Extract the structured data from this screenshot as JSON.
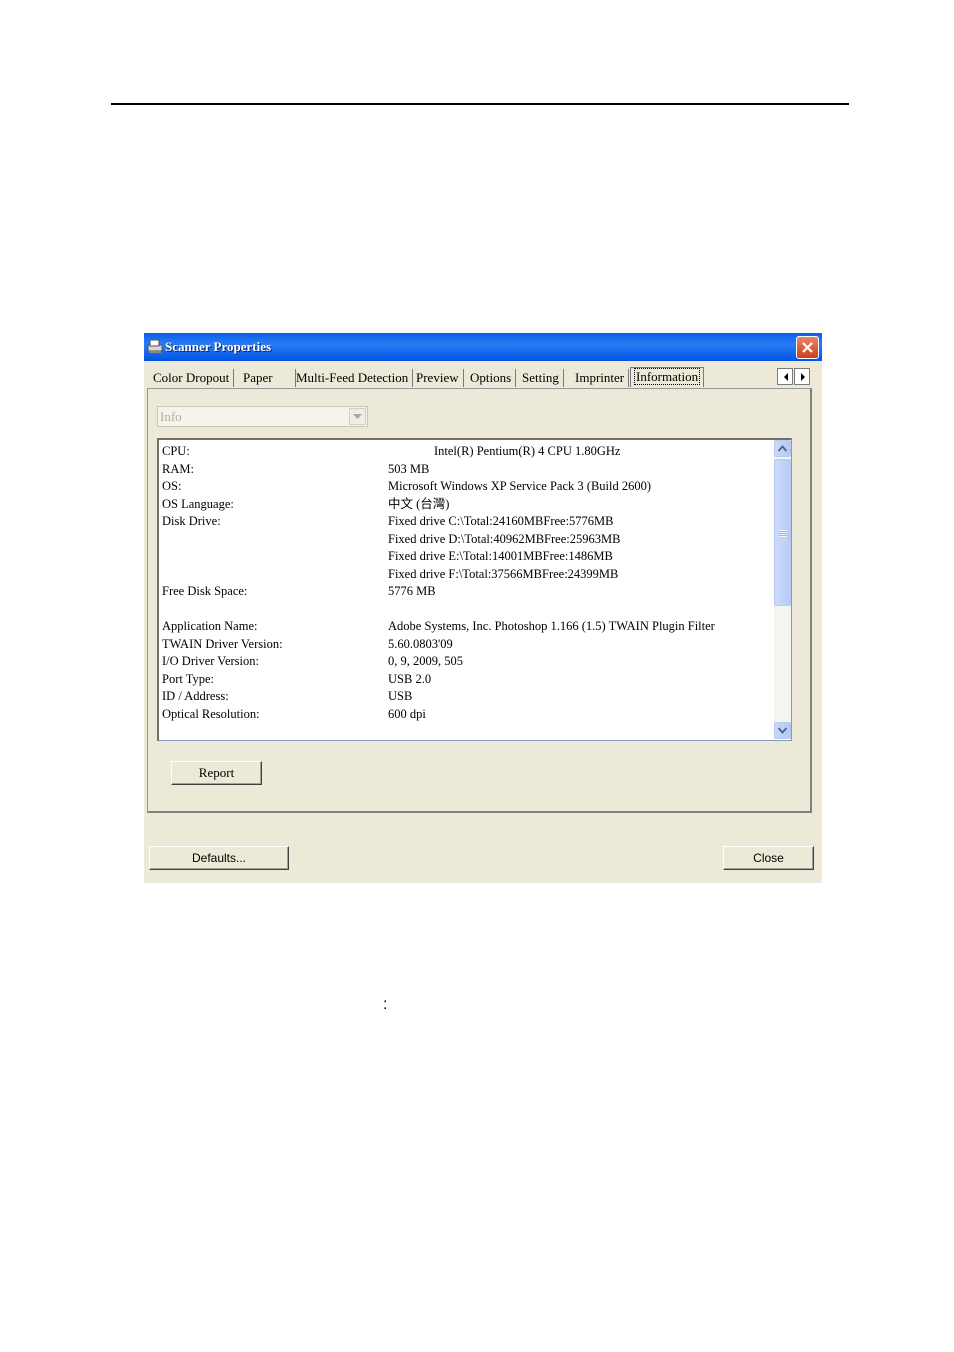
{
  "window": {
    "title": "Scanner Properties"
  },
  "tabs": [
    {
      "label": "Color Dropout"
    },
    {
      "label": "Paper"
    },
    {
      "label": "Multi-Feed Detection"
    },
    {
      "label": "Preview"
    },
    {
      "label": "Options"
    },
    {
      "label": "Setting"
    },
    {
      "label": "Imprinter"
    },
    {
      "label": "Information",
      "active": true
    }
  ],
  "combo": {
    "value": "Info"
  },
  "info": {
    "rows": [
      {
        "label": "CPU:",
        "value": "Intel(R) Pentium(R) 4 CPU 1.80GHz"
      },
      {
        "label": "RAM:",
        "value": "503 MB"
      },
      {
        "label": "OS:",
        "value": "Microsoft Windows XP Service Pack 3 (Build 2600)"
      },
      {
        "label": "OS Language:",
        "value": "中文 (台灣)"
      },
      {
        "label": "Disk Drive:",
        "value": "Fixed drive C:\\Total:24160MBFree:5776MB"
      },
      {
        "label": "",
        "value": "Fixed drive D:\\Total:40962MBFree:25963MB"
      },
      {
        "label": "",
        "value": "Fixed drive E:\\Total:14001MBFree:1486MB"
      },
      {
        "label": "",
        "value": "Fixed drive F:\\Total:37566MBFree:24399MB"
      },
      {
        "label": "Free Disk Space:",
        "value": "5776 MB"
      },
      {
        "label": "Application Name:",
        "value": "Adobe Systems, Inc. Photoshop 1.166 (1.5) TWAIN Plugin Filter"
      },
      {
        "label": "TWAIN Driver Version:",
        "value": "5.60.0803'09"
      },
      {
        "label": "I/O Driver Version:",
        "value": "0, 9, 2009, 505"
      },
      {
        "label": "Port Type:",
        "value": "USB 2.0"
      },
      {
        "label": "ID / Address:",
        "value": "USB"
      },
      {
        "label": "Optical Resolution:",
        "value": "600 dpi"
      }
    ]
  },
  "buttons": {
    "report": "Report",
    "defaults": "Defaults...",
    "close": "Close"
  },
  "page": {
    "colon": ":"
  },
  "colors": {
    "titlebar": "#0054e3",
    "dialog_bg": "#ece9d8",
    "close_button": "#c9401f"
  },
  "icons": [
    "scanner-icon",
    "close-icon",
    "chevron-left-icon",
    "chevron-right-icon",
    "chevron-down-icon",
    "scroll-up-icon",
    "scroll-down-icon"
  ]
}
